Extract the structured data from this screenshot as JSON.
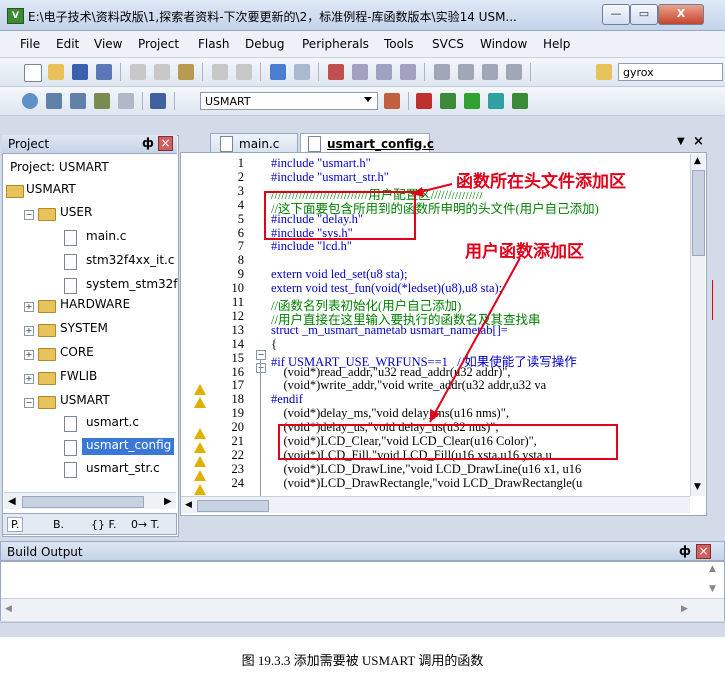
{
  "window": {
    "title": "E:\\电子技术\\资料改版\\1,探索者资料-下次要更新的\\2，标准例程-库函数版本\\实验14 USM...",
    "app_icon": "keil-uvision-icon",
    "min_label": "—",
    "max_label": "▭",
    "close_label": "X"
  },
  "menu": [
    "File",
    "Edit",
    "View",
    "Project",
    "Flash",
    "Debug",
    "Peripherals",
    "Tools",
    "SVCS",
    "Window",
    "Help"
  ],
  "toolbar1": {
    "search_value": "gyrox"
  },
  "toolbar2": {
    "target_value": "USMART"
  },
  "project_panel": {
    "header": "Project",
    "pin": "ф",
    "close": "×",
    "tree": [
      {
        "label": "Project: USMART",
        "kind": "root"
      },
      {
        "label": "USMART",
        "kind": "target"
      },
      {
        "label": "USER",
        "kind": "group"
      },
      {
        "label": "main.c",
        "kind": "file"
      },
      {
        "label": "stm32f4xx_it.c",
        "kind": "file"
      },
      {
        "label": "system_stm32f",
        "kind": "file"
      },
      {
        "label": "HARDWARE",
        "kind": "group"
      },
      {
        "label": "SYSTEM",
        "kind": "group"
      },
      {
        "label": "CORE",
        "kind": "group"
      },
      {
        "label": "FWLIB",
        "kind": "group"
      },
      {
        "label": "USMART",
        "kind": "group"
      },
      {
        "label": "usmart.c",
        "kind": "file"
      },
      {
        "label": "usmart_config",
        "kind": "file",
        "selected": true
      },
      {
        "label": "usmart_str.c",
        "kind": "file"
      }
    ],
    "bottom_tabs": [
      "P.",
      "B.",
      "{} F.",
      "0→ T."
    ]
  },
  "editor": {
    "tabs": [
      {
        "label": "main.c",
        "active": false
      },
      {
        "label": "usmart_config.c",
        "active": true
      }
    ],
    "tab_menu": "▼",
    "tab_close": "×",
    "line_numbers": [
      "1",
      "2",
      "3",
      "4",
      "5",
      "6",
      "7",
      "8",
      "9",
      "10",
      "11",
      "12",
      "13",
      "14",
      "15",
      "16",
      "17",
      "18",
      "19",
      "20",
      "21",
      "22",
      "23",
      "24"
    ],
    "lines": [
      "#include \"usmart.h\"",
      "#include \"usmart_str.h\"",
      "////////////////////////////用户配置区///////////////",
      "//这下面要包含所用到的函数所申明的头文件(用户自己添加)",
      "#include \"delay.h\"",
      "#include \"sys.h\"",
      "#include \"lcd.h\"",
      "",
      "extern void led_set(u8 sta);",
      "extern void test_fun(void(*ledset)(u8),u8 sta);",
      "//函数名列表初始化(用户自己添加)",
      "//用户直接在这里输入要执行的函数名及其查找串",
      "struct _m_usmart_nametab usmart_nametab[]=",
      "{",
      "#if USMART_USE_WRFUNS==1   //如果使能了读写操作",
      "    (void*)read_addr,\"u32 read_addr(u32 addr)\",",
      "    (void*)write_addr,\"void write_addr(u32 addr,u32 va",
      "#endif",
      "    (void*)delay_ms,\"void delay_ms(u16 nms)\",",
      "    (void*)delay_us,\"void delay_us(u32 nus)\",",
      "    (void*)LCD_Clear,\"void LCD_Clear(u16 Color)\",",
      "    (void*)LCD_Fill,\"void LCD_Fill(u16 xsta,u16 ysta,u",
      "    (void*)LCD_DrawLine,\"void LCD_DrawLine(u16 x1, u16",
      "    (void*)LCD_DrawRectangle,\"void LCD_DrawRectangle(u"
    ],
    "annotation_header": "函数所在头文件添加区",
    "annotation_user": "用户函数添加区"
  },
  "build_output": {
    "title": "Build Output",
    "pin": "ф",
    "close": "×"
  },
  "caption": "图 19.3.3 添加需要被 USMART 调用的函数"
}
